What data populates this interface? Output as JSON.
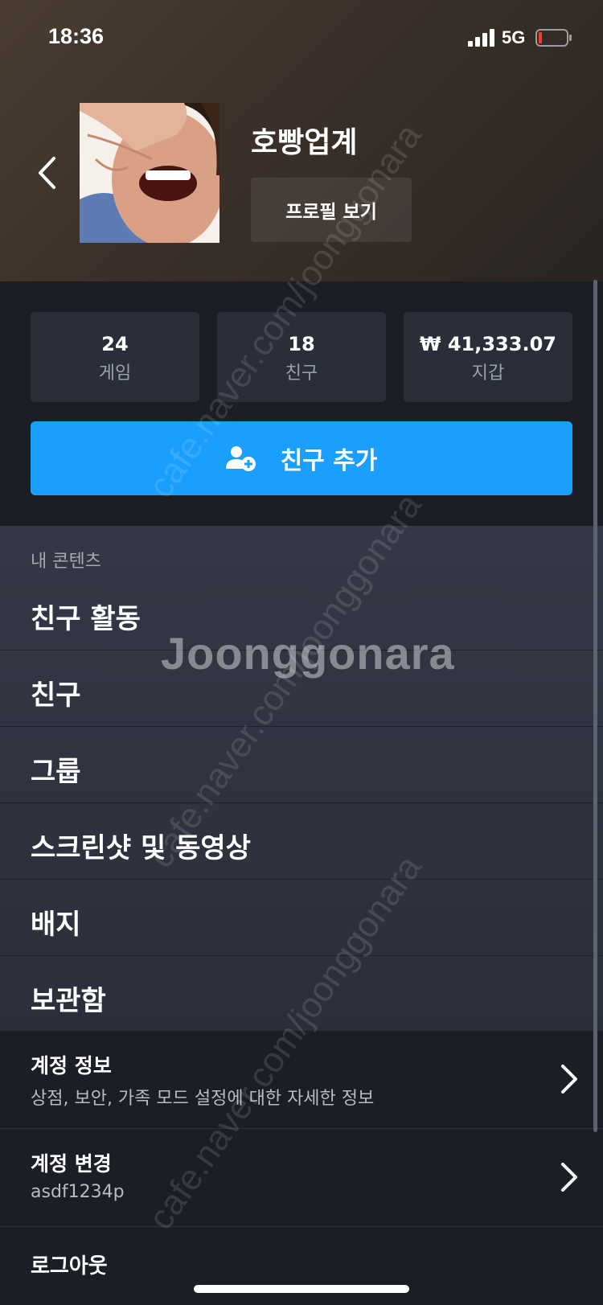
{
  "status_bar": {
    "time": "18:36",
    "network": "5G"
  },
  "header": {
    "username": "호빵업계",
    "profile_button": "프로필 보기"
  },
  "stats": [
    {
      "value": "24",
      "label": "게임"
    },
    {
      "value": "18",
      "label": "친구"
    },
    {
      "value": "₩ 41,333.07",
      "label": "지갑"
    }
  ],
  "add_friend": {
    "label": "친구 추가"
  },
  "content_menu": {
    "section_title": "내 콘텐츠",
    "items": [
      {
        "label": "친구 활동"
      },
      {
        "label": "친구"
      },
      {
        "label": "그룹"
      },
      {
        "label": "스크린샷 및 동영상"
      },
      {
        "label": "배지"
      },
      {
        "label": "보관함"
      }
    ]
  },
  "account": {
    "info_title": "계정 정보",
    "info_sub": "상점, 보안, 가족 모드 설정에 대한 자세한 정보",
    "switch_title": "계정 변경",
    "switch_sub": "asdf1234p",
    "logout": "로그아웃"
  },
  "watermark": {
    "brand": "Joonggonara",
    "url": "cafe.naver.com/joonggonara"
  },
  "colors": {
    "accent": "#1a9fff",
    "panel": "#2a2e39",
    "background": "#1c1e25"
  }
}
